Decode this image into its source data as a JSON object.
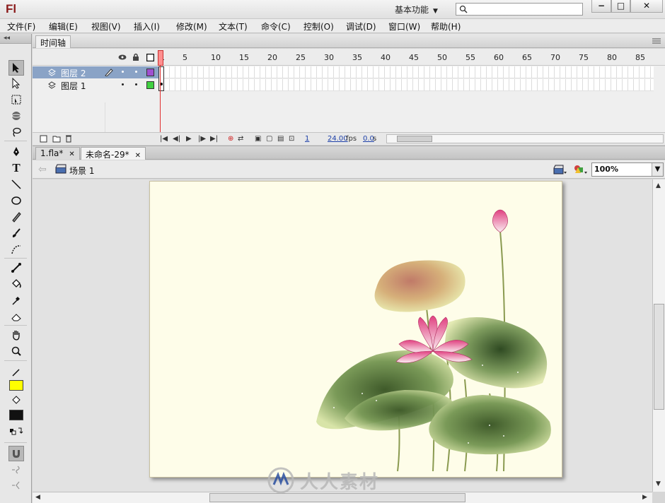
{
  "app": {
    "logo": "Fl",
    "workspace": "基本功能",
    "window_buttons": {
      "minimize": "−",
      "maximize": "□",
      "close": "✕"
    }
  },
  "menubar": {
    "items": [
      "文件(F)",
      "编辑(E)",
      "视图(V)",
      "插入(I)",
      "修改(M)",
      "文本(T)",
      "命令(C)",
      "控制(O)",
      "调试(D)",
      "窗口(W)",
      "帮助(H)"
    ]
  },
  "timeline": {
    "tab_label": "时间轴",
    "ruler": [
      "1",
      "5",
      "10",
      "15",
      "20",
      "25",
      "30",
      "35",
      "40",
      "45",
      "50",
      "55",
      "60",
      "65",
      "70",
      "75",
      "80",
      "85"
    ],
    "layers": [
      {
        "name": "图层 2",
        "selected": true,
        "color": "#a050d0"
      },
      {
        "name": "图层 1",
        "selected": false,
        "color": "#40d040"
      }
    ],
    "status": {
      "frame": "1",
      "fps": "24.00",
      "fps_unit": "fps",
      "time": "0.0",
      "time_unit": "s"
    }
  },
  "documents": {
    "tabs": [
      {
        "label": "1.fla*",
        "active": false
      },
      {
        "label": "未命名-29*",
        "active": true
      }
    ]
  },
  "editbar": {
    "scene_label": "场景 1",
    "zoom": "100%"
  },
  "stage": {
    "background": "#fefde9"
  },
  "watermark": {
    "text": "人人素材"
  },
  "colors": {
    "stroke": "#ffff00",
    "fill": "#111111"
  }
}
